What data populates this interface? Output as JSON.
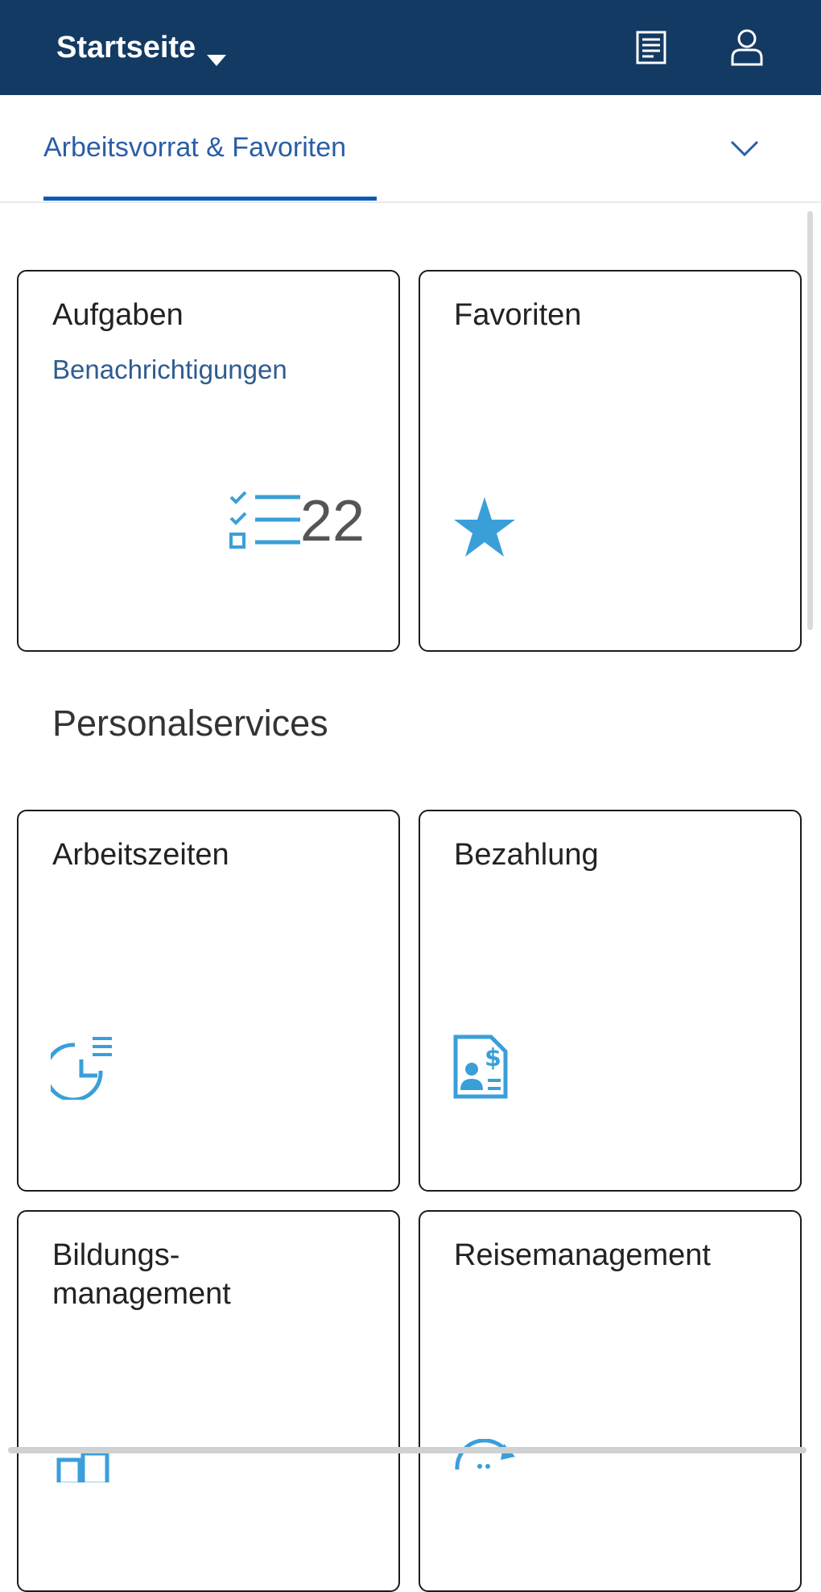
{
  "header": {
    "title": "Startseite",
    "bg_color": "#133a63",
    "icons": [
      "notifications-list-icon",
      "user-icon"
    ]
  },
  "tabs": {
    "active_label": "Arbeitsvorrat & Favoriten",
    "accent_color": "#0a5bb5"
  },
  "worklist": {
    "tasks": {
      "title": "Aufgaben",
      "subtitle": "Benachrichtigungen",
      "count": "22",
      "icon": "task-list-icon"
    },
    "favorites": {
      "title": "Favoriten",
      "icon": "star-icon"
    }
  },
  "personal_services": {
    "title": "Personalservices",
    "tiles": [
      {
        "title": "Arbeitszeiten",
        "icon": "time-entry-icon"
      },
      {
        "title": "Bezahlung",
        "icon": "payslip-icon"
      },
      {
        "title": "Bildungs-\nmanagement",
        "icon": "learning-icon"
      },
      {
        "title": "Reisemanagement",
        "icon": "travel-icon"
      }
    ]
  },
  "icon_color": "#3a9fd9"
}
